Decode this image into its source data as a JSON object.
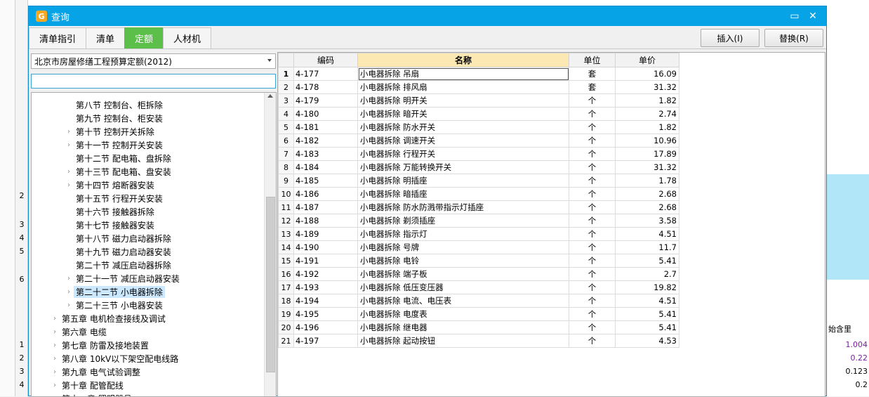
{
  "background": {
    "row_numbers": [
      "2",
      "3",
      "4",
      "5",
      "6",
      "1",
      "2",
      "3",
      "4"
    ],
    "right_header": "始含里",
    "right_values": [
      "1.004",
      "0.22",
      "0.123",
      "0.2"
    ]
  },
  "dialog": {
    "title": "查询",
    "tabs": [
      "清单指引",
      "清单",
      "定额",
      "人材机"
    ],
    "active_tab": "定额",
    "insert_label": "插入(I)",
    "replace_label": "替换(R)",
    "library_value": "北京市房屋修缮工程预算定额(2012)",
    "filter_value": ""
  },
  "tree": {
    "items": [
      {
        "label": "第八节 控制台、柜拆除",
        "level": 2,
        "expandable": false
      },
      {
        "label": "第九节 控制台、柜安装",
        "level": 2,
        "expandable": false
      },
      {
        "label": "第十节 控制开关拆除",
        "level": 2,
        "expandable": true
      },
      {
        "label": "第十一节 控制开关安装",
        "level": 2,
        "expandable": true
      },
      {
        "label": "第十二节 配电箱、盘拆除",
        "level": 2,
        "expandable": false
      },
      {
        "label": "第十三节 配电箱、盘安装",
        "level": 2,
        "expandable": true
      },
      {
        "label": "第十四节 熔断器安装",
        "level": 2,
        "expandable": true
      },
      {
        "label": "第十五节 行程开关安装",
        "level": 2,
        "expandable": false
      },
      {
        "label": "第十六节 接触器拆除",
        "level": 2,
        "expandable": false
      },
      {
        "label": "第十七节 接触器安装",
        "level": 2,
        "expandable": false
      },
      {
        "label": "第十八节 磁力启动器拆除",
        "level": 2,
        "expandable": false
      },
      {
        "label": "第十九节 磁力启动器安装",
        "level": 2,
        "expandable": false
      },
      {
        "label": "第二十节 减压启动器拆除",
        "level": 2,
        "expandable": false
      },
      {
        "label": "第二十一节 减压启动器安装",
        "level": 2,
        "expandable": true
      },
      {
        "label": "第二十二节 小电器拆除",
        "level": 2,
        "expandable": true,
        "selected": true
      },
      {
        "label": "第二十三节 小电器安装",
        "level": 2,
        "expandable": true
      },
      {
        "label": "第五章 电机检查接线及调试",
        "level": 1,
        "expandable": true
      },
      {
        "label": "第六章 电缆",
        "level": 1,
        "expandable": true
      },
      {
        "label": "第七章 防雷及接地装置",
        "level": 1,
        "expandable": true
      },
      {
        "label": "第八章 10kV以下架空配电线路",
        "level": 1,
        "expandable": true
      },
      {
        "label": "第九章 电气试验调整",
        "level": 1,
        "expandable": true
      },
      {
        "label": "第十章 配管配线",
        "level": 1,
        "expandable": true
      },
      {
        "label": "第十一章 照明器具",
        "level": 1,
        "expandable": true
      }
    ]
  },
  "grid": {
    "headers": {
      "code": "编码",
      "name": "名称",
      "unit": "单位",
      "price": "单价"
    },
    "rows": [
      {
        "n": "1",
        "code": "4-177",
        "name": "小电器拆除 吊扇",
        "unit": "套",
        "price": "16.09"
      },
      {
        "n": "2",
        "code": "4-178",
        "name": "小电器拆除 排风扇",
        "unit": "套",
        "price": "31.32"
      },
      {
        "n": "3",
        "code": "4-179",
        "name": "小电器拆除 明开关",
        "unit": "个",
        "price": "1.82"
      },
      {
        "n": "4",
        "code": "4-180",
        "name": "小电器拆除 暗开关",
        "unit": "个",
        "price": "2.74"
      },
      {
        "n": "5",
        "code": "4-181",
        "name": "小电器拆除 防水开关",
        "unit": "个",
        "price": "1.82"
      },
      {
        "n": "6",
        "code": "4-182",
        "name": "小电器拆除 调速开关",
        "unit": "个",
        "price": "10.96"
      },
      {
        "n": "7",
        "code": "4-183",
        "name": "小电器拆除 行程开关",
        "unit": "个",
        "price": "17.89"
      },
      {
        "n": "8",
        "code": "4-184",
        "name": "小电器拆除 万能转换开关",
        "unit": "个",
        "price": "31.32"
      },
      {
        "n": "9",
        "code": "4-185",
        "name": "小电器拆除 明插座",
        "unit": "个",
        "price": "1.78"
      },
      {
        "n": "10",
        "code": "4-186",
        "name": "小电器拆除 暗插座",
        "unit": "个",
        "price": "2.68"
      },
      {
        "n": "11",
        "code": "4-187",
        "name": "小电器拆除 防水防溅带指示灯插座",
        "unit": "个",
        "price": "2.68"
      },
      {
        "n": "12",
        "code": "4-188",
        "name": "小电器拆除 剃须插座",
        "unit": "个",
        "price": "3.58"
      },
      {
        "n": "13",
        "code": "4-189",
        "name": "小电器拆除 指示灯",
        "unit": "个",
        "price": "4.51"
      },
      {
        "n": "14",
        "code": "4-190",
        "name": "小电器拆除 号牌",
        "unit": "个",
        "price": "11.7"
      },
      {
        "n": "15",
        "code": "4-191",
        "name": "小电器拆除 电铃",
        "unit": "个",
        "price": "5.41"
      },
      {
        "n": "16",
        "code": "4-192",
        "name": "小电器拆除 端子板",
        "unit": "个",
        "price": "2.7"
      },
      {
        "n": "17",
        "code": "4-193",
        "name": "小电器拆除 低压变压器",
        "unit": "个",
        "price": "19.82"
      },
      {
        "n": "18",
        "code": "4-194",
        "name": "小电器拆除 电流、电压表",
        "unit": "个",
        "price": "4.51"
      },
      {
        "n": "19",
        "code": "4-195",
        "name": "小电器拆除 电度表",
        "unit": "个",
        "price": "5.41"
      },
      {
        "n": "20",
        "code": "4-196",
        "name": "小电器拆除 继电器",
        "unit": "个",
        "price": "5.41"
      },
      {
        "n": "21",
        "code": "4-197",
        "name": "小电器拆除 起动按钮",
        "unit": "个",
        "price": "4.53"
      }
    ]
  }
}
